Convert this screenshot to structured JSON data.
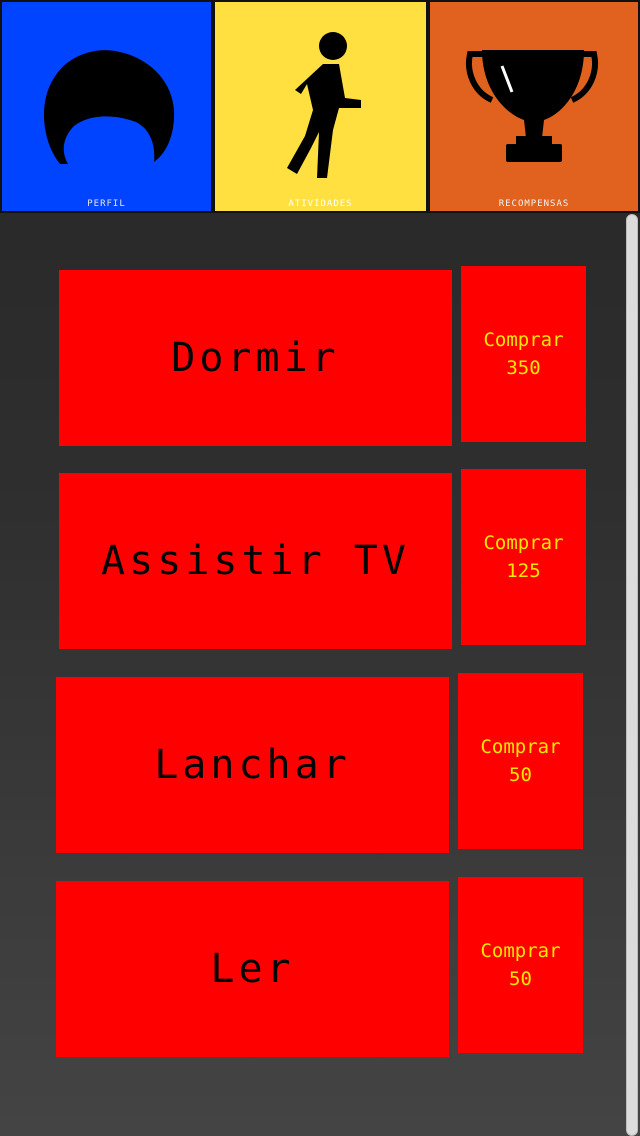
{
  "tabs": [
    {
      "id": "perfil",
      "label": "PERFIL",
      "icon": "hair-icon",
      "bg": "#0044ff",
      "label_color": "#e8e8e8"
    },
    {
      "id": "atividades",
      "label": "ATIVIDADES",
      "icon": "walking-person-icon",
      "bg": "#ffe040",
      "label_color": "#ffffff"
    },
    {
      "id": "recompensas",
      "label": "RECOMPENSAS",
      "icon": "trophy-icon",
      "bg": "#e0621e",
      "label_color": "#f4f4f4"
    }
  ],
  "rewards": [
    {
      "name": "Dormir",
      "buy_label": "Comprar",
      "price": "350"
    },
    {
      "name": "Assistir TV",
      "buy_label": "Comprar",
      "price": "125"
    },
    {
      "name": "Lanchar",
      "buy_label": "Comprar",
      "price": "50"
    },
    {
      "name": "Ler",
      "buy_label": "Comprar",
      "price": "50"
    }
  ],
  "colors": {
    "reward_bg": "#ff0000",
    "price_text": "#ffe600",
    "name_text": "#050505"
  }
}
